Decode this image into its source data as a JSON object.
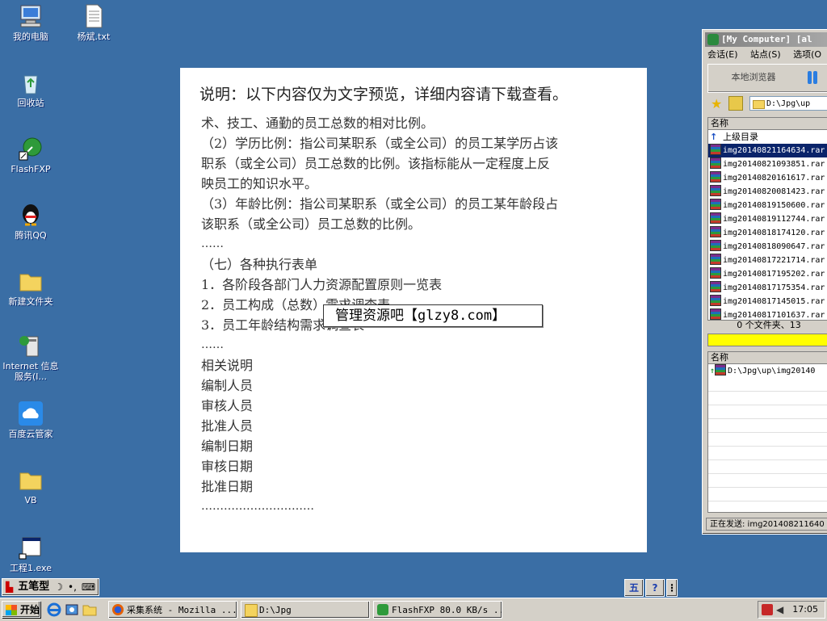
{
  "desktop": {
    "icons": [
      {
        "label": "我的电脑"
      },
      {
        "label": "杨斌.txt"
      },
      {
        "label": "回收站"
      },
      {
        "label": "FlashFXP"
      },
      {
        "label": "腾讯QQ"
      },
      {
        "label": "新建文件夹"
      },
      {
        "label": "Internet 信息服务(I..."
      },
      {
        "label": "百度云管家"
      },
      {
        "label": "VB"
      },
      {
        "label": "工程1.exe"
      }
    ]
  },
  "document": {
    "heading": "说明：以下内容仅为文字预览，详细内容请下载查看。",
    "lines": [
      "术、技工、通勤的员工总数的相对比例。",
      "（2）学历比例：指公司某职系（或全公司）的员工某学历占该",
      "职系（或全公司）员工总数的比例。该指标能从一定程度上反",
      "映员工的知识水平。",
      "（3）年龄比例：指公司某职系（或全公司）的员工某年龄段占",
      "该职系（或全公司）员工总数的比例。",
      "……",
      "（七）各种执行表单",
      "1．各阶段各部门人力资源配置原则一览表",
      "2．员工构成（总数）需求调查表",
      "3．员工年龄结构需求调查表",
      "……",
      "相关说明",
      "编制人员",
      "审核人员",
      "批准人员",
      "编制日期",
      "审核日期",
      "批准日期",
      "…………………………"
    ],
    "tooltip": "管理资源吧【glzy8.com】"
  },
  "flashfxp": {
    "title": "[My Computer]  [al",
    "menu": [
      "会话(E)",
      "站点(S)",
      "选项(O"
    ],
    "local_browser_label": "本地浏览器",
    "path": "D:\\Jpg\\up",
    "column_name": "名称",
    "parent_dir": "上级目录",
    "files": [
      "img20140821164634.rar",
      "img20140821093851.rar",
      "img20140820161617.rar",
      "img20140820081423.rar",
      "img20140819150600.rar",
      "img20140819112744.rar",
      "img20140818174120.rar",
      "img20140818090647.rar",
      "img20140817221714.rar",
      "img20140817195202.rar",
      "img20140817175354.rar",
      "img20140817145015.rar",
      "img20140817101637.rar"
    ],
    "status_summary": "0 个文件夹、13",
    "queue_column": "名称",
    "queue_item": "D:\\Jpg\\up\\img20140",
    "sending_status": "正在发送: img201408211640"
  },
  "ime": {
    "mode": "五笔型",
    "symbols": [
      "☽",
      "•,",
      "⌨"
    ]
  },
  "lang_bar": {
    "label": "五",
    "help": "?"
  },
  "taskbar": {
    "start_label": "开始",
    "tasks": [
      {
        "label": "采集系统 - Mozilla ..."
      },
      {
        "label": "D:\\Jpg"
      },
      {
        "label": "FlashFXP 80.0 KB/s ..."
      }
    ],
    "clock": "17:05"
  },
  "colors": {
    "desktop": "#3a6ea5",
    "taskbar": "#d4d0c8",
    "progress": "#ffff00"
  }
}
